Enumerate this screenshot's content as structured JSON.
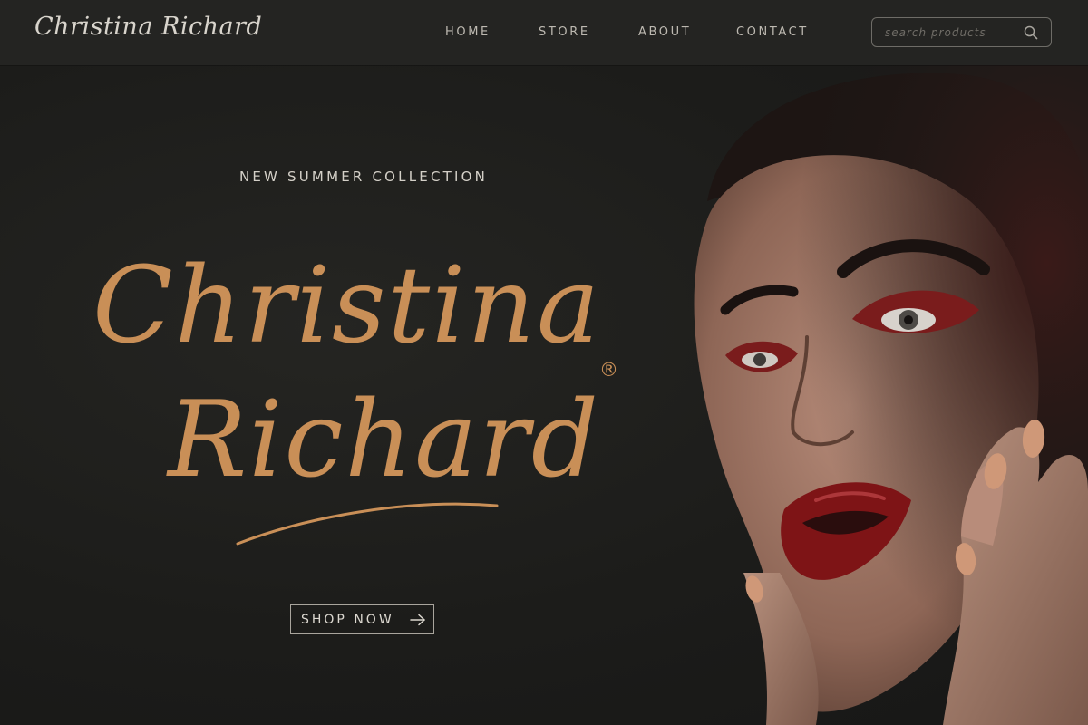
{
  "header": {
    "logo_text": "Christina Richard",
    "nav": {
      "home": "HOME",
      "store": "STORE",
      "about": "ABOUT",
      "contact": "CONTACT"
    },
    "search": {
      "placeholder": "search products",
      "icon": "search-icon"
    }
  },
  "hero": {
    "eyebrow": "NEW SUMMER COLLECTION",
    "brand_first": "Christina",
    "brand_last": "Richard",
    "registered_mark": "®",
    "cta_label": "SHOP NOW",
    "cta_icon": "arrow-right-icon"
  },
  "colors": {
    "background": "#1c1c1a",
    "nav_bar": "#242422",
    "accent": "#c98f57",
    "text_light": "#d4d0c8"
  }
}
